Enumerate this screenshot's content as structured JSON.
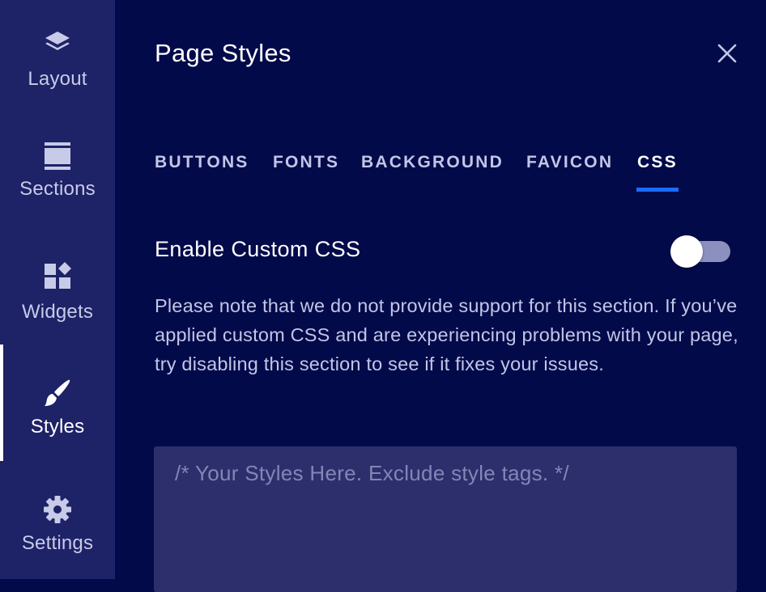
{
  "sidebar": {
    "items": [
      {
        "label": "Layout",
        "icon": "layers-icon"
      },
      {
        "label": "Sections",
        "icon": "sections-icon"
      },
      {
        "label": "Widgets",
        "icon": "widgets-icon"
      },
      {
        "label": "Styles",
        "icon": "brush-icon",
        "active": true
      },
      {
        "label": "Settings",
        "icon": "gear-icon"
      }
    ]
  },
  "panel": {
    "title": "Page Styles",
    "close_icon": "close-icon"
  },
  "tabs": [
    {
      "label": "BUTTONS"
    },
    {
      "label": "FONTS"
    },
    {
      "label": "BACKGROUND"
    },
    {
      "label": "FAVICON"
    },
    {
      "label": "CSS",
      "active": true
    }
  ],
  "custom_css": {
    "toggle_label": "Enable Custom CSS",
    "enabled": false,
    "notice": "Please note that we do not provide support for this section. If you’ve applied custom CSS and are experiencing problems with your page, try disabling this section to see if it fixes your issues.",
    "editor_value": "",
    "editor_placeholder": "/* Your Styles Here. Exclude style tags. */"
  },
  "colors": {
    "background": "#030a4a",
    "sidebar": "#1e2266",
    "accent": "#1a6cff",
    "editor_bg": "#2c2f6c"
  }
}
